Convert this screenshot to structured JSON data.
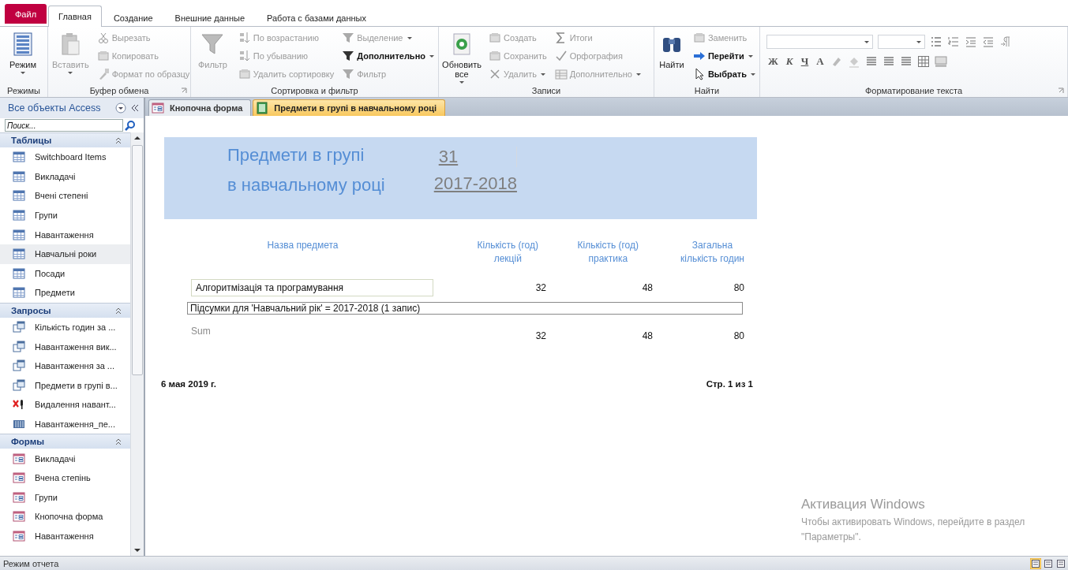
{
  "ribbon": {
    "tabs": [
      {
        "label": "Файл",
        "kind": "file",
        "selected": false
      },
      {
        "label": "Главная",
        "kind": "tab",
        "selected": true
      },
      {
        "label": "Создание",
        "kind": "tab",
        "selected": false
      },
      {
        "label": "Внешние данные",
        "kind": "tab",
        "selected": false
      },
      {
        "label": "Работа с базами данных",
        "kind": "tab",
        "selected": false
      }
    ],
    "groups": [
      {
        "label": "Режимы",
        "kind": "standard",
        "launcher": false,
        "large": [
          {
            "label": "Режим",
            "disabled": false,
            "dropdown": true
          }
        ]
      },
      {
        "label": "Буфер обмена",
        "kind": "standard",
        "launcher": true,
        "large": [
          {
            "label": "Вставить",
            "disabled": true,
            "dropdown": true
          }
        ],
        "columns": [
          [
            {
              "label": "Вырезать",
              "disabled": true,
              "dropdown": false
            },
            {
              "label": "Копировать",
              "disabled": true,
              "dropdown": false
            },
            {
              "label": "Формат по образцу",
              "disabled": true,
              "dropdown": false
            }
          ]
        ]
      },
      {
        "label": "Сортировка и фильтр",
        "kind": "standard",
        "launcher": false,
        "large": [
          {
            "label": "Фильтр",
            "disabled": true,
            "dropdown": false
          }
        ],
        "columns": [
          [
            {
              "label": "По возрастанию",
              "disabled": true,
              "dropdown": false
            },
            {
              "label": "По убыванию",
              "disabled": true,
              "dropdown": false
            },
            {
              "label": "Удалить сортировку",
              "disabled": true,
              "dropdown": false
            }
          ],
          [
            {
              "label": "Выделение",
              "disabled": true,
              "dropdown": true
            },
            {
              "label": "Дополнительно",
              "disabled": false,
              "dropdown": true
            },
            {
              "label": "Фильтр",
              "disabled": true,
              "dropdown": false
            }
          ]
        ]
      },
      {
        "label": "Записи",
        "kind": "standard",
        "launcher": false,
        "large": [
          {
            "label": "Обновить все",
            "disabled": false,
            "dropdown": true
          }
        ],
        "columns": [
          [
            {
              "label": "Создать",
              "disabled": true,
              "dropdown": false
            },
            {
              "label": "Сохранить",
              "disabled": true,
              "dropdown": false
            },
            {
              "label": "Удалить",
              "disabled": true,
              "dropdown": true
            }
          ],
          [
            {
              "label": "Итоги",
              "disabled": true,
              "dropdown": false
            },
            {
              "label": "Орфография",
              "disabled": true,
              "dropdown": false
            },
            {
              "label": "Дополнительно",
              "disabled": true,
              "dropdown": true
            }
          ]
        ]
      },
      {
        "label": "Найти",
        "kind": "standard",
        "launcher": false,
        "large": [
          {
            "label": "Найти",
            "disabled": false,
            "dropdown": false
          }
        ],
        "columns": [
          [
            {
              "label": "Заменить",
              "disabled": true,
              "dropdown": false
            },
            {
              "label": "Перейти",
              "disabled": false,
              "dropdown": true
            },
            {
              "label": "Выбрать",
              "disabled": false,
              "dropdown": true
            }
          ]
        ]
      },
      {
        "label": "Форматирование текста",
        "kind": "format",
        "launcher": true,
        "letters": [
          "Ж",
          "К",
          "Ч",
          "A"
        ]
      }
    ]
  },
  "navigation": {
    "title": "Все объекты Access",
    "search": {
      "placeholder": "Поиск..."
    },
    "sections": [
      {
        "label": "Таблицы",
        "items": [
          {
            "label": "Switchboard Items",
            "kind": "table",
            "selected": false
          },
          {
            "label": "Викладачі",
            "kind": "table",
            "selected": false
          },
          {
            "label": "Вчені степені",
            "kind": "table",
            "selected": false
          },
          {
            "label": "Групи",
            "kind": "table",
            "selected": false
          },
          {
            "label": "Навантаження",
            "kind": "table",
            "selected": false
          },
          {
            "label": "Навчальні роки",
            "kind": "table",
            "selected": true
          },
          {
            "label": "Посади",
            "kind": "table",
            "selected": false
          },
          {
            "label": "Предмети",
            "kind": "table",
            "selected": false
          }
        ]
      },
      {
        "label": "Запросы",
        "items": [
          {
            "label": "Кількість годин за ...",
            "kind": "query",
            "selected": false
          },
          {
            "label": "Навантаження вик...",
            "kind": "query",
            "selected": false
          },
          {
            "label": "Навантаження за ...",
            "kind": "query",
            "selected": false
          },
          {
            "label": "Предмети в групі в...",
            "kind": "query",
            "selected": false
          },
          {
            "label": "Видалення навант...",
            "kind": "delete",
            "selected": false
          },
          {
            "label": "Навантаження_пе...",
            "kind": "maketable",
            "selected": false
          }
        ]
      },
      {
        "label": "Формы",
        "items": [
          {
            "label": "Викладачі",
            "kind": "form",
            "selected": false
          },
          {
            "label": "Вчена степінь",
            "kind": "form",
            "selected": false
          },
          {
            "label": "Групи",
            "kind": "form",
            "selected": false
          },
          {
            "label": "Кнопочна форма",
            "kind": "form",
            "selected": false
          },
          {
            "label": "Навантаження",
            "kind": "form",
            "selected": false
          }
        ]
      }
    ]
  },
  "document_tabs": [
    {
      "label": "Кнопочна форма",
      "kind": "form",
      "selected": false
    },
    {
      "label": "Предмети в групі в навчальному році",
      "kind": "report",
      "selected": true
    }
  ],
  "report": {
    "title_lines": [
      "Предмети в групі",
      "в навчальному році"
    ],
    "group": "31",
    "year": "2017-2018",
    "columns": [
      "Назва предмета",
      "Кількість (год)\nлекцій",
      "Кількість (год)\nпрактика",
      "Загальна\nкількість годин"
    ],
    "rows": [
      {
        "subject": "Алгоритмізація та програмування",
        "lectures": "32",
        "practice": "48",
        "total": "80"
      }
    ],
    "summary": "Підсумки для 'Навчальний рік' =  2017-2018 (1 запис)",
    "sum": {
      "label": "Sum",
      "lectures": "32",
      "practice": "48",
      "total": "80"
    },
    "date": "6 мая 2019 г.",
    "page": "Стр. 1 из 1"
  },
  "activation": {
    "title": "Активация Windows",
    "text": "Чтобы активировать Windows, перейдите в раздел \"Параметры\"."
  },
  "status_bar": {
    "mode": "Режим отчета",
    "views": [
      {
        "selected": true
      },
      {
        "selected": false
      },
      {
        "selected": false
      }
    ]
  }
}
